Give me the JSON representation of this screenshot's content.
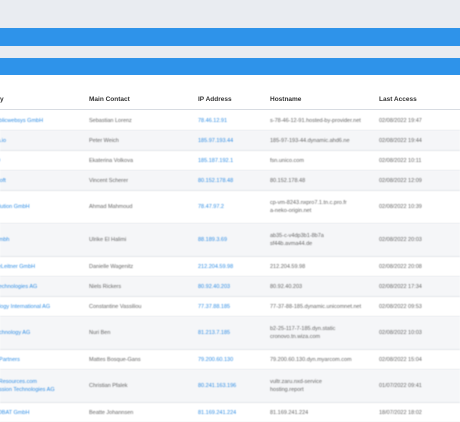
{
  "table": {
    "headers": {
      "company": "ny",
      "contact": "Main Contact",
      "ip": "IP Address",
      "hostname": "Hostname",
      "last_access": "Last Access"
    },
    "rows": [
      {
        "company": [
          "ublicwebsys GmbH"
        ],
        "contact": "Sebastian Lorenz",
        "ip": "78.46.12.91",
        "hostname": [
          "s-78-46-12-91.hosted-by-provider.net"
        ],
        "last_access": "02/08/2022 19:47"
      },
      {
        "company": [
          "ia.io"
        ],
        "contact": "Peter Weich",
        "ip": "185.97.193.44",
        "hostname": [
          "185-97-193-44.dynamic.ahd6.ne"
        ],
        "last_access": "02/08/2022 19:44"
      },
      {
        "company": [
          "O"
        ],
        "contact": "Ekaterina Volkova",
        "ip": "185.187.192.1",
        "hostname": [
          "fsn.unico.com"
        ],
        "last_access": "02/08/2022 10:11"
      },
      {
        "company": [
          "Soft"
        ],
        "contact": "Vincent Scherer",
        "ip": "80.152.178.48",
        "hostname": [
          "80.152.178.48"
        ],
        "last_access": "02/08/2022 12:09"
      },
      {
        "company": [
          "olution GmbH"
        ],
        "contact": "Ahmad Mahmoud",
        "ip": "78.47.97.2",
        "hostname": [
          "cp-vm-8243.nxpro7.1.tn.c.pro.fr",
          "a-neko-origin.net"
        ],
        "last_access": "02/08/2022 10:39"
      },
      {
        "company": [
          "Jmbh"
        ],
        "contact": "Ulrike El Halimi",
        "ip": "88.189.3.69",
        "hostname": [
          "ab35-c-v4dp3b1-8b7a",
          "sf44b.avma44.de"
        ],
        "last_access": "02/08/2022 20:03"
      },
      {
        "company": [
          "reLeitner GmbH"
        ],
        "contact": "Danielle Wagenitz",
        "ip": "212.204.59.98",
        "hostname": [
          "212.204.59.98"
        ],
        "last_access": "02/08/2022 20:08"
      },
      {
        "company": [
          "Technologies AG"
        ],
        "contact": "Niels Rickers",
        "ip": "80.92.40.203",
        "hostname": [
          "80.92.40.203"
        ],
        "last_access": "02/08/2022 17:34"
      },
      {
        "company": [
          "ology International AG"
        ],
        "contact": "Constantine Vassiliou",
        "ip": "77.37.88.185",
        "hostname": [
          "77-37-88-185.dynamic.unicomnet.net"
        ],
        "last_access": "02/08/2022 09:53"
      },
      {
        "company": [
          "echnology AG"
        ],
        "contact": "Nuri Ben",
        "ip": "81.213.7.185",
        "hostname": [
          "b2-25-117-7-185.dyn.static",
          "cronovo.tn.wiza.com"
        ],
        "last_access": "02/08/2022 10:03"
      },
      {
        "company": [
          "gPartners"
        ],
        "contact": "Mattes Bosque-Gans",
        "ip": "79.200.60.130",
        "hostname": [
          "79.200.60.130.dyn.myarcom.com"
        ],
        "last_access": "02/08/2022 15:04"
      },
      {
        "company": [
          "vResources.com",
          "ession Technologies AG"
        ],
        "contact": "Christian Pfalek",
        "ip": "80.241.163.196",
        "hostname": [
          "vultr.zaru.nxd-service",
          "hosting.report"
        ],
        "last_access": "01/07/2022 09:41"
      },
      {
        "company": [
          "IOBAT GmbH"
        ],
        "contact": "Beatte Johannsen",
        "ip": "81.169.241.224",
        "hostname": [
          "81.169.241.224"
        ],
        "last_access": "18/07/2022 18:02"
      }
    ]
  }
}
